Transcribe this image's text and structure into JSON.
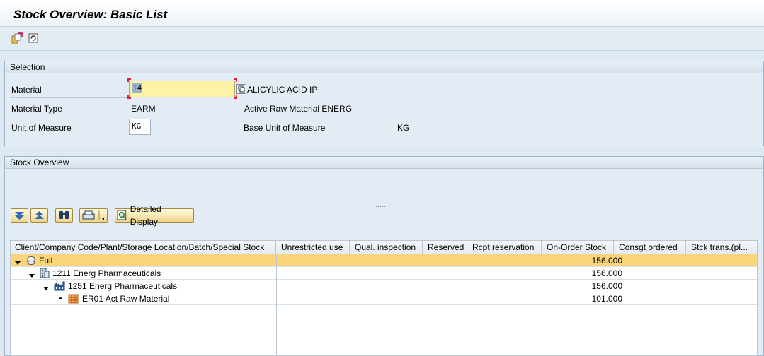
{
  "title": "Stock Overview: Basic List",
  "toolbar": {
    "icons": [
      "select-icon",
      "refresh-icon"
    ]
  },
  "selection": {
    "title": "Selection",
    "material_label": "Material",
    "material_value": "14",
    "material_desc": "ALICYLIC ACID IP",
    "material_type_label": "Material Type",
    "material_type_value": "EARM",
    "material_type_desc": "Active Raw Material ENERG",
    "uom_label": "Unit of Measure",
    "uom_value": "KG",
    "base_uom_label": "Base Unit of Measure",
    "base_uom_value": "KG"
  },
  "stock": {
    "title": "Stock Overview",
    "splitter": "....."
  },
  "buttons": {
    "detailed_display": "Detailed Display"
  },
  "table": {
    "columns": [
      "Client/Company Code/Plant/Storage Location/Batch/Special Stock",
      "Unrestricted use",
      "Qual. inspection",
      "Reserved",
      "Rcpt reservation",
      "On-Order Stock",
      "Consgt ordered",
      "Stck trans.(pl..."
    ],
    "rows": [
      {
        "label": "Full",
        "on_order": "156.000"
      },
      {
        "label": "1211 Energ Pharmaceuticals",
        "on_order": "156.000"
      },
      {
        "label": "1251 Energ Pharmaceuticals",
        "on_order": "156.000"
      },
      {
        "label": "ER01 Act Raw Material",
        "on_order": "101.000"
      }
    ]
  },
  "colors": {
    "selected_row": "#fcd47a",
    "focus_field": "#fdf3a5"
  }
}
